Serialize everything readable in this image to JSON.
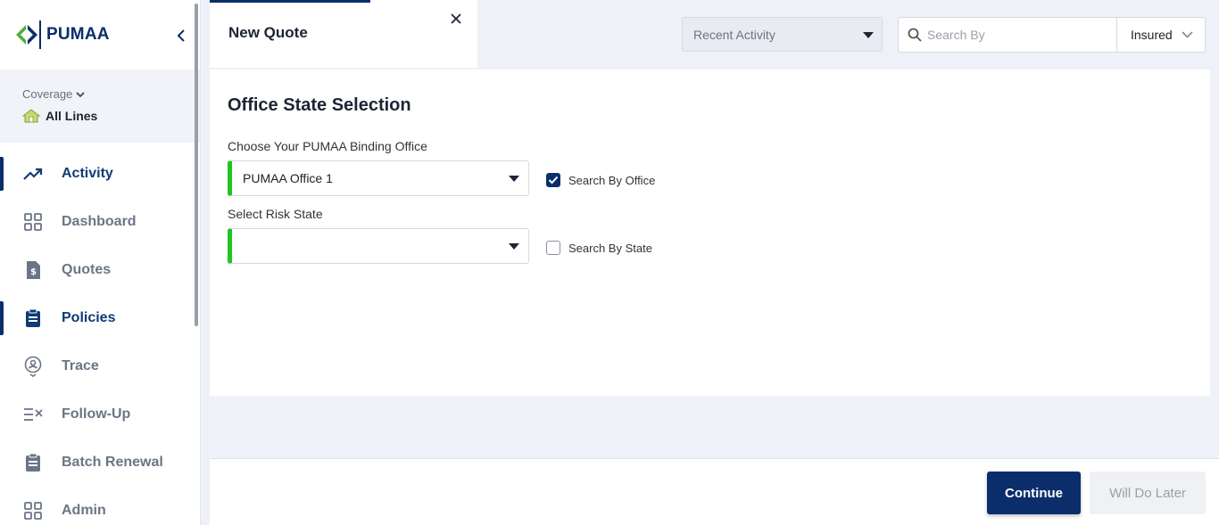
{
  "brand": {
    "name": "PUMAA",
    "primary_color": "#0b2e6b",
    "accent_color": "#21c51e"
  },
  "sidebar": {
    "coverage_label": "Coverage",
    "coverage_value": "All Lines",
    "items": [
      {
        "label": "Activity",
        "icon": "trending-up-icon",
        "active": true
      },
      {
        "label": "Dashboard",
        "icon": "grid-icon",
        "active": false
      },
      {
        "label": "Quotes",
        "icon": "dollar-document-icon",
        "active": false
      },
      {
        "label": "Policies",
        "icon": "clipboard-icon",
        "active": true
      },
      {
        "label": "Trace",
        "icon": "location-person-icon",
        "active": false
      },
      {
        "label": "Follow-Up",
        "icon": "list-check-icon",
        "active": false
      },
      {
        "label": "Batch Renewal",
        "icon": "clipboard-icon",
        "active": false
      },
      {
        "label": "Admin",
        "icon": "grid-icon",
        "active": false
      }
    ]
  },
  "tab": {
    "title": "New Quote"
  },
  "header": {
    "recent_activity": "Recent Activity",
    "search_placeholder": "Search By",
    "search_type": "Insured"
  },
  "form": {
    "title": "Office State Selection",
    "office_label": "Choose Your PUMAA Binding Office",
    "office_value": "PUMAA Office 1",
    "search_by_office_label": "Search By Office",
    "search_by_office_checked": true,
    "state_label": "Select Risk State",
    "state_value": "",
    "search_by_state_label": "Search By State",
    "search_by_state_checked": false
  },
  "footer": {
    "continue_label": "Continue",
    "later_label": "Will Do Later"
  }
}
